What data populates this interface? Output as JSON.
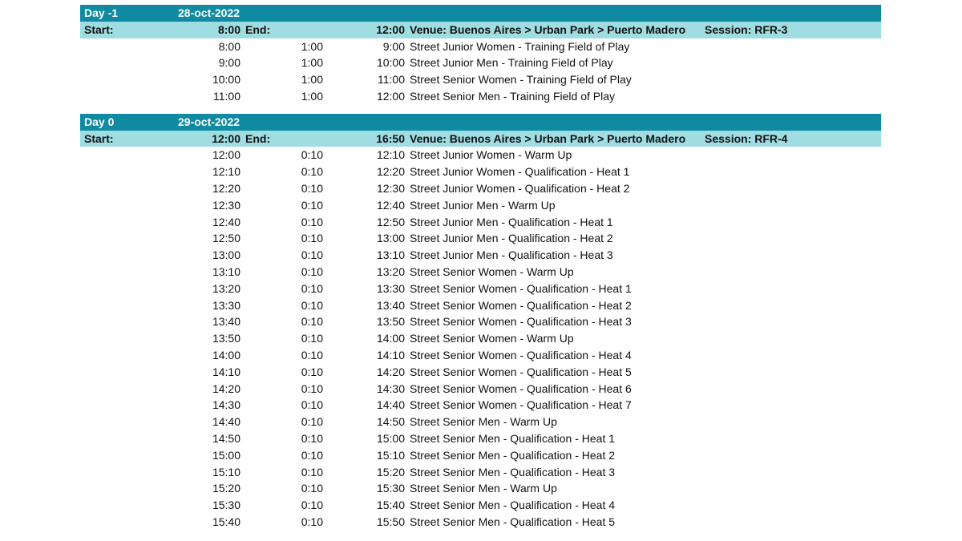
{
  "days": [
    {
      "day_label": "Day -1",
      "date": "28-oct-2022",
      "start_label": "Start:",
      "start": "8:00",
      "end_label": "End:",
      "end": "12:00",
      "venue": "Venue: Buenos Aires > Urban Park > Puerto Madero",
      "session": "Session: RFR-3",
      "events": [
        {
          "start": "8:00",
          "duration": "1:00",
          "end": "9:00",
          "title": "Street Junior Women - Training Field of Play"
        },
        {
          "start": "9:00",
          "duration": "1:00",
          "end": "10:00",
          "title": "Street Junior Men - Training Field of Play"
        },
        {
          "start": "10:00",
          "duration": "1:00",
          "end": "11:00",
          "title": "Street Senior Women - Training Field of Play"
        },
        {
          "start": "11:00",
          "duration": "1:00",
          "end": "12:00",
          "title": "Street Senior Men - Training Field of Play"
        }
      ]
    },
    {
      "day_label": "Day 0",
      "date": "29-oct-2022",
      "start_label": "Start:",
      "start": "12:00",
      "end_label": "End:",
      "end": "16:50",
      "venue": "Venue: Buenos Aires > Urban Park > Puerto Madero",
      "session": "Session: RFR-4",
      "events": [
        {
          "start": "12:00",
          "duration": "0:10",
          "end": "12:10",
          "title": "Street Junior Women - Warm Up"
        },
        {
          "start": "12:10",
          "duration": "0:10",
          "end": "12:20",
          "title": "Street Junior Women - Qualification - Heat 1"
        },
        {
          "start": "12:20",
          "duration": "0:10",
          "end": "12:30",
          "title": "Street Junior Women - Qualification - Heat 2"
        },
        {
          "start": "12:30",
          "duration": "0:10",
          "end": "12:40",
          "title": "Street Junior Men - Warm Up"
        },
        {
          "start": "12:40",
          "duration": "0:10",
          "end": "12:50",
          "title": "Street Junior Men - Qualification - Heat 1"
        },
        {
          "start": "12:50",
          "duration": "0:10",
          "end": "13:00",
          "title": "Street Junior Men - Qualification - Heat 2"
        },
        {
          "start": "13:00",
          "duration": "0:10",
          "end": "13:10",
          "title": "Street Junior Men - Qualification - Heat 3"
        },
        {
          "start": "13:10",
          "duration": "0:10",
          "end": "13:20",
          "title": "Street Senior Women - Warm Up"
        },
        {
          "start": "13:20",
          "duration": "0:10",
          "end": "13:30",
          "title": "Street Senior Women - Qualification - Heat 1"
        },
        {
          "start": "13:30",
          "duration": "0:10",
          "end": "13:40",
          "title": "Street Senior Women - Qualification - Heat 2"
        },
        {
          "start": "13:40",
          "duration": "0:10",
          "end": "13:50",
          "title": "Street Senior Women - Qualification - Heat 3"
        },
        {
          "start": "13:50",
          "duration": "0:10",
          "end": "14:00",
          "title": "Street Senior Women - Warm Up"
        },
        {
          "start": "14:00",
          "duration": "0:10",
          "end": "14:10",
          "title": "Street Senior Women - Qualification - Heat 4"
        },
        {
          "start": "14:10",
          "duration": "0:10",
          "end": "14:20",
          "title": "Street Senior Women - Qualification - Heat 5"
        },
        {
          "start": "14:20",
          "duration": "0:10",
          "end": "14:30",
          "title": "Street Senior Women - Qualification - Heat 6"
        },
        {
          "start": "14:30",
          "duration": "0:10",
          "end": "14:40",
          "title": "Street Senior Women - Qualification - Heat 7"
        },
        {
          "start": "14:40",
          "duration": "0:10",
          "end": "14:50",
          "title": "Street Senior Men - Warm Up"
        },
        {
          "start": "14:50",
          "duration": "0:10",
          "end": "15:00",
          "title": "Street Senior Men - Qualification - Heat 1"
        },
        {
          "start": "15:00",
          "duration": "0:10",
          "end": "15:10",
          "title": "Street Senior Men - Qualification - Heat 2"
        },
        {
          "start": "15:10",
          "duration": "0:10",
          "end": "15:20",
          "title": "Street Senior Men - Qualification - Heat 3"
        },
        {
          "start": "15:20",
          "duration": "0:10",
          "end": "15:30",
          "title": "Street Senior Men - Warm Up"
        },
        {
          "start": "15:30",
          "duration": "0:10",
          "end": "15:40",
          "title": "Street Senior Men - Qualification - Heat 4"
        },
        {
          "start": "15:40",
          "duration": "0:10",
          "end": "15:50",
          "title": "Street Senior Men - Qualification - Heat 5"
        }
      ]
    }
  ],
  "colors": {
    "day_bar": "#0f8aa0",
    "info_bar": "#9fdde2"
  }
}
